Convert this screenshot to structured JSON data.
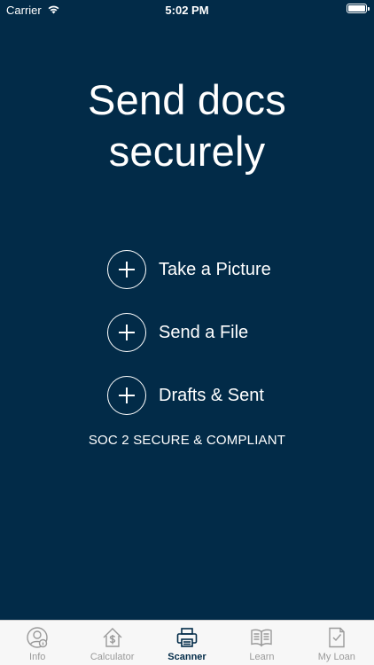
{
  "status_bar": {
    "carrier": "Carrier",
    "time": "5:02 PM",
    "battery_level": 1.0
  },
  "headline": {
    "line1": "Send docs",
    "line2": "securely"
  },
  "actions": [
    {
      "label": "Take a Picture",
      "icon": "plus-circle-icon"
    },
    {
      "label": "Send a File",
      "icon": "plus-circle-icon"
    },
    {
      "label": "Drafts & Sent",
      "icon": "plus-circle-icon"
    }
  ],
  "compliance_text": "SOC 2 SECURE & COMPLIANT",
  "tabbar": {
    "active": "Scanner",
    "tabs": [
      {
        "label": "Info",
        "icon": "person-info-icon"
      },
      {
        "label": "Calculator",
        "icon": "house-dollar-icon"
      },
      {
        "label": "Scanner",
        "icon": "printer-icon"
      },
      {
        "label": "Learn",
        "icon": "open-book-icon"
      },
      {
        "label": "My Loan",
        "icon": "document-check-icon"
      }
    ]
  },
  "colors": {
    "background": "#022b48",
    "text": "#ffffff",
    "tabbar_bg": "#f7f7f7",
    "tab_inactive": "#9a9a9a",
    "tab_active": "#022b48"
  }
}
